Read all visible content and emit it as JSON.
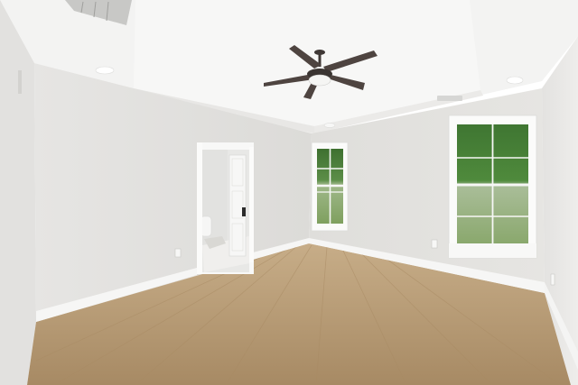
{
  "scene": {
    "subject": "empty-room-interior",
    "colors": {
      "ceiling": "#f4f4f3",
      "wall_left": "#dedddb",
      "wall_back": "#e7e6e4",
      "wall_right": "#e9e8e6",
      "baseboard": "#f7f7f6",
      "floor_light": "#c2a57e",
      "floor_dark": "#9d7f5a",
      "window_frame": "#fbfbfa",
      "glass_green": "#4c7f3c",
      "lawn": "#86a66a",
      "fan_blade": "#4e4440"
    },
    "icons": {
      "fan": "ceiling-fan-icon",
      "vent": "air-vent-icon",
      "light": "recessed-light-icon",
      "outlet": "wall-outlet-icon"
    }
  }
}
